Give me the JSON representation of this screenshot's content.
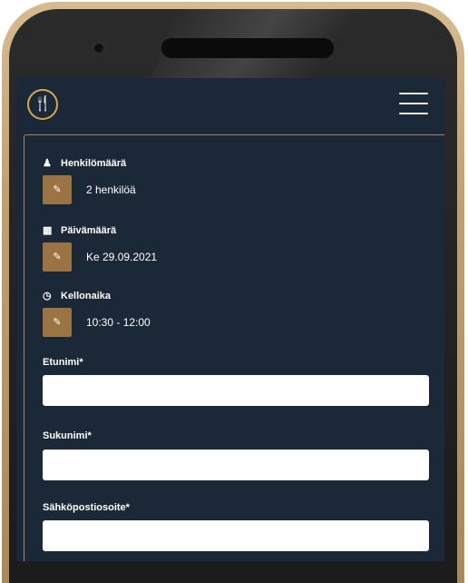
{
  "header": {
    "logo_icon": "🍴",
    "menu_icon": "hamburger-icon"
  },
  "selections": {
    "people": {
      "label": "Henkilömäärä",
      "icon": "user-icon",
      "value": "2 henkilöä"
    },
    "date": {
      "label": "Päivämäärä",
      "icon": "calendar-icon",
      "value": "Ke 29.09.2021"
    },
    "time": {
      "label": "Kellonaika",
      "icon": "clock-icon",
      "value": "10:30 - 12:00"
    },
    "edit_glyph": "✎"
  },
  "form": {
    "first_name": {
      "label": "Etunimi*",
      "value": ""
    },
    "last_name": {
      "label": "Sukunimi*",
      "value": ""
    },
    "email": {
      "label": "Sähköpostiosoite*",
      "value": ""
    }
  },
  "colors": {
    "background": "#1b2838",
    "accent": "#9c7443",
    "logo": "#d4a84b",
    "panel_border": "#a8865a"
  }
}
